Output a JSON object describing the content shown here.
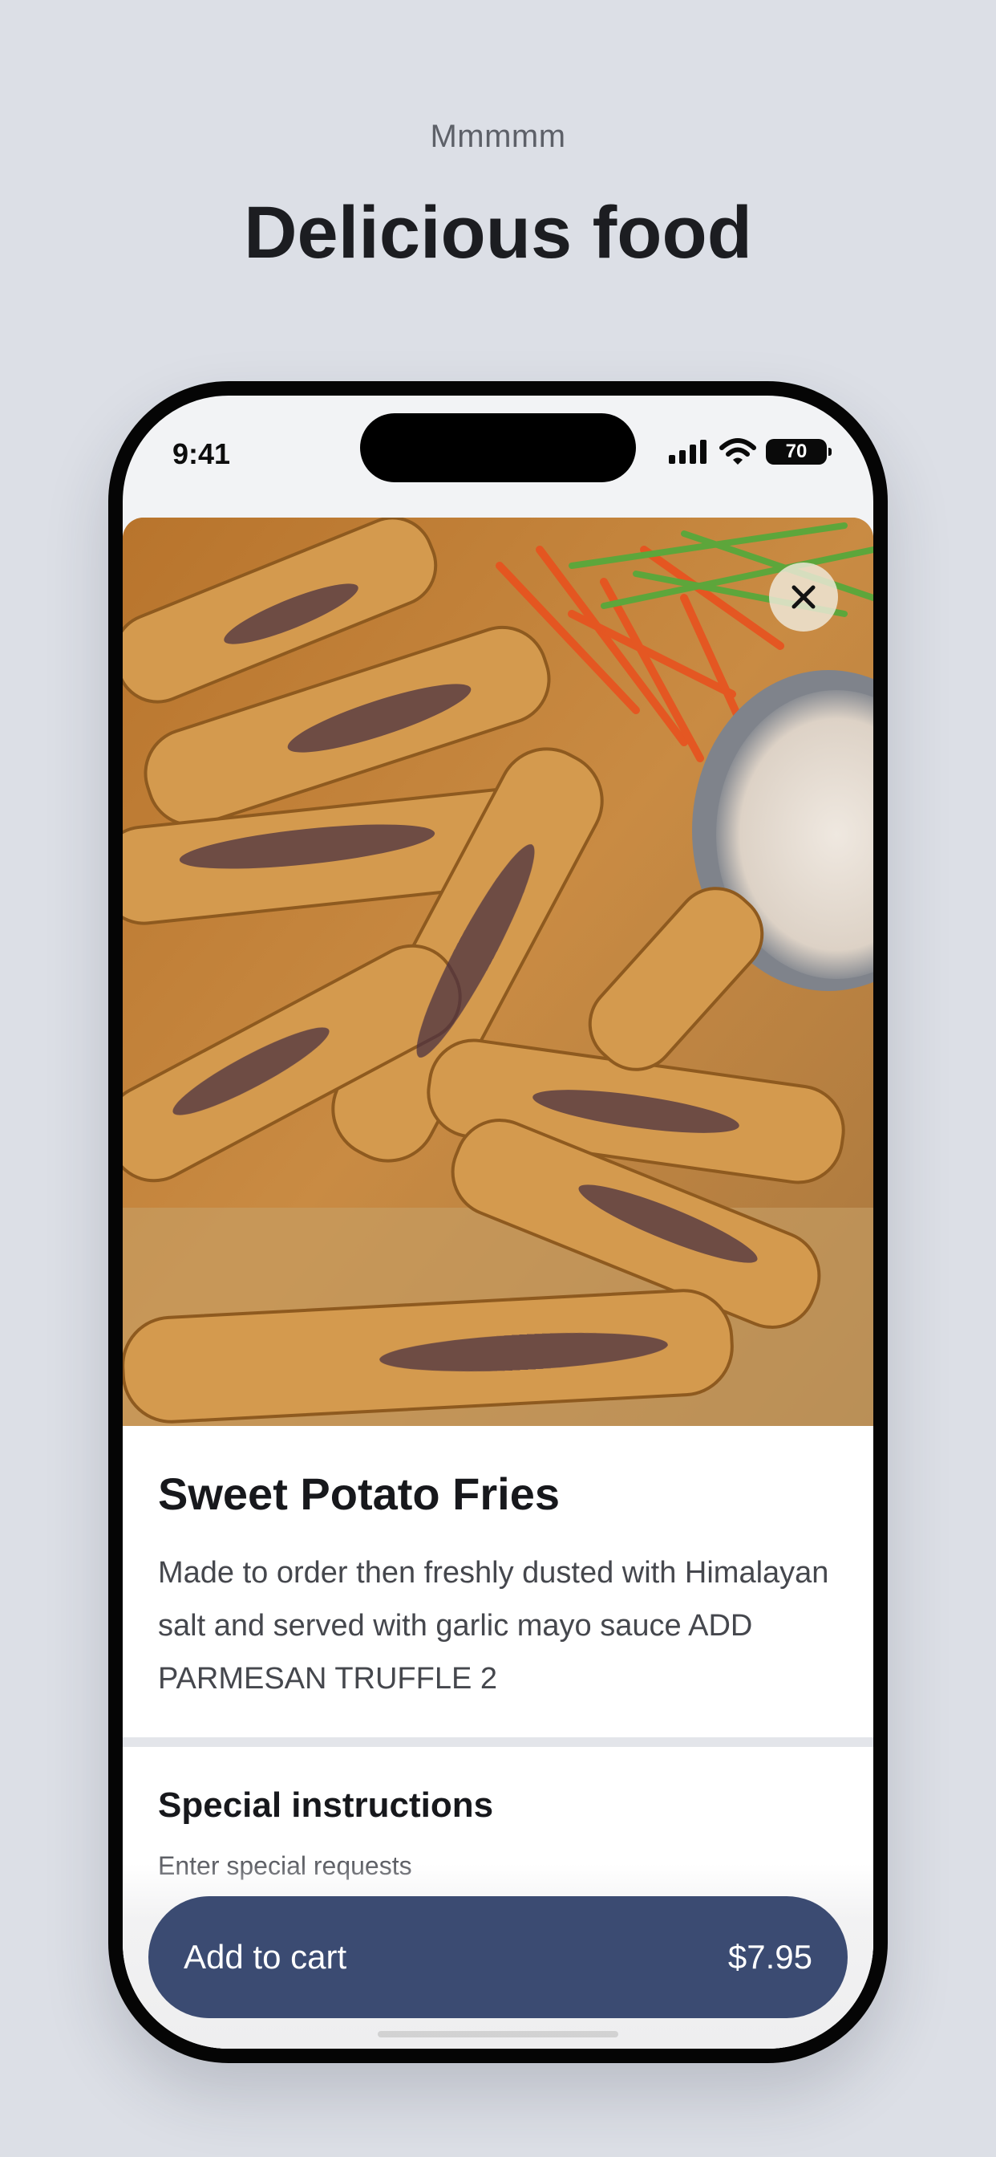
{
  "header": {
    "eyebrow": "Mmmmm",
    "title": "Delicious food"
  },
  "status_bar": {
    "time": "9:41",
    "battery_level": "70",
    "icons": [
      "signal-icon",
      "wifi-icon",
      "battery-icon"
    ]
  },
  "item": {
    "title": "Sweet Potato Fries",
    "description": "Made to order then freshly dusted with Himalayan salt and served with garlic mayo sauce ADD PARMESAN TRUFFLE 2",
    "image": "fried-sweet-potato-fries-photo"
  },
  "special_instructions": {
    "title": "Special instructions",
    "placeholder": "Enter special requests",
    "value": ""
  },
  "cart_button": {
    "label": "Add to cart",
    "price": "$7.95"
  },
  "close_icon": "close-icon",
  "colors": {
    "background": "#dcdfe6",
    "accent": "#3b4b72",
    "text": "#17181c"
  }
}
